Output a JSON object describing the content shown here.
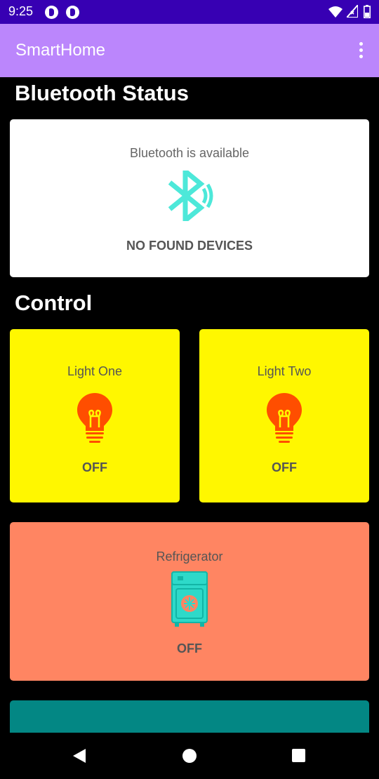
{
  "status_bar": {
    "time": "9:25"
  },
  "app_bar": {
    "title": "SmartHome"
  },
  "bluetooth": {
    "heading": "Bluetooth Status",
    "availability": "Bluetooth is available",
    "devices": "NO FOUND DEVICES",
    "icon": "bluetooth-searching-icon"
  },
  "control": {
    "heading": "Control",
    "light_one": {
      "label": "Light One",
      "state": "OFF",
      "icon": "lightbulb-icon"
    },
    "light_two": {
      "label": "Light Two",
      "state": "OFF",
      "icon": "lightbulb-icon"
    },
    "refrigerator": {
      "label": "Refrigerator",
      "state": "OFF",
      "icon": "refrigerator-icon"
    }
  },
  "colors": {
    "status_bar": "#3700B3",
    "app_bar": "#BB86FC",
    "light_card": "#FFF700",
    "refrigerator_card": "#FF8562",
    "next_card": "#038784",
    "bulb": "#FF4E00",
    "accent_teal": "#4DE8D9"
  }
}
